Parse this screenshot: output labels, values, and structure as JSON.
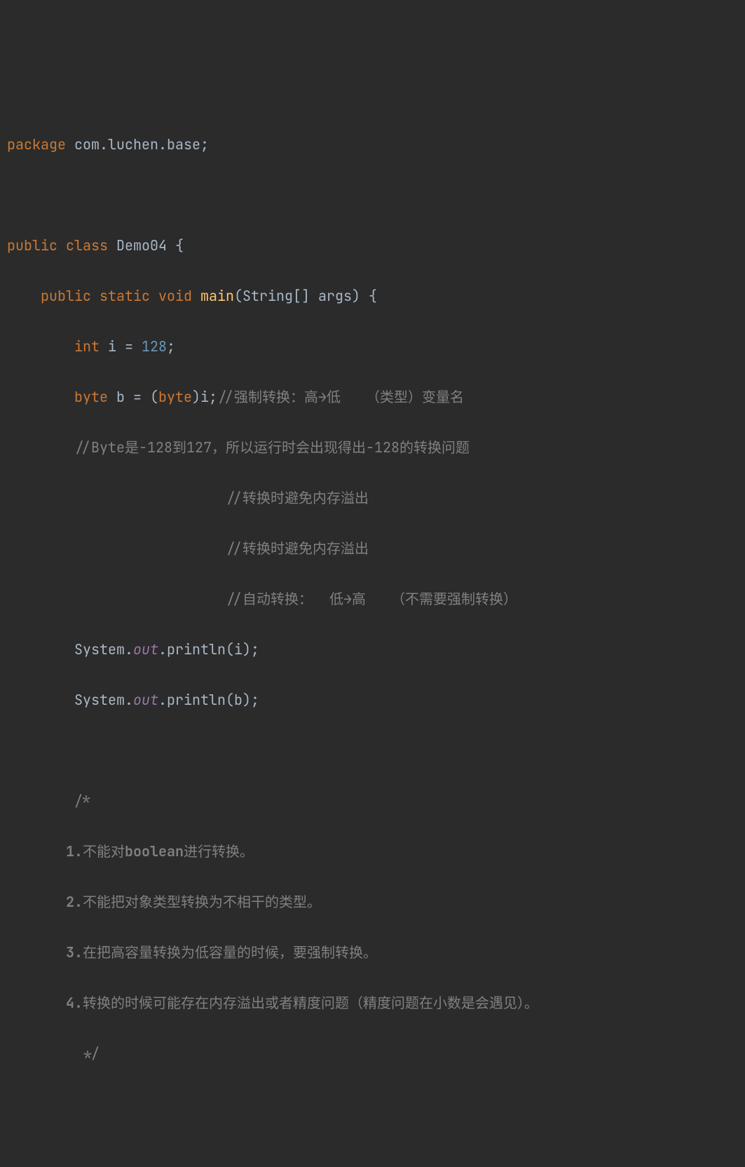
{
  "code": {
    "line1": {
      "package_kw": "package",
      "package_name": " com.luchen.base",
      "semi": ";"
    },
    "line3": {
      "public_kw": "public ",
      "class_kw": "class",
      "class_name": " Demo04 ",
      "brace": "{"
    },
    "line4": {
      "indent": "    ",
      "public_kw": "public ",
      "static_kw": "static ",
      "void_kw": "void",
      "method_name": " main",
      "params": "(String[] args) ",
      "brace": "{"
    },
    "line5": {
      "indent": "        ",
      "type_kw": "int",
      "var": " i = ",
      "number": "128",
      "semi": ";"
    },
    "line6": {
      "indent": "        ",
      "type_kw": "byte",
      "var": " b = (",
      "cast_kw": "byte",
      "rest": ")i",
      "semi": ";",
      "comment": "//强制转换：高→低   （类型）变量名"
    },
    "line7": {
      "indent": "        ",
      "comment_prefix": "//Byte是-128到127，所以运行时会出现得出-128的转换问题"
    },
    "line8": {
      "indent": "                          ",
      "comment": "//转换时避免内存溢出"
    },
    "line9": {
      "indent": "                          ",
      "comment": "//转换时避免内存溢出"
    },
    "line10": {
      "indent": "                          ",
      "comment": "//自动转换：  低→高   （不需要强制转换）"
    },
    "line11": {
      "indent": "        ",
      "system": "System.",
      "out": "out",
      "println": ".println(i)",
      "semi": ";"
    },
    "line12": {
      "indent": "        ",
      "system": "System.",
      "out": "out",
      "println": ".println(b)",
      "semi": ";"
    },
    "line14": {
      "indent": "        ",
      "comment": "/*"
    },
    "line15": {
      "indent": "       ",
      "bold": "1.",
      "text": "不能对",
      "bold2": "boolean",
      "text2": "进行转换。"
    },
    "line16": {
      "indent": "       ",
      "bold": "2.",
      "text": "不能把对象类型转换为不相干的类型。"
    },
    "line17": {
      "indent": "       ",
      "bold": "3.",
      "text": "在把高容量转换为低容量的时候，要强制转换。"
    },
    "line18": {
      "indent": "       ",
      "bold": "4.",
      "text": "转换的时候可能存在内存溢出或者精度问题（精度问题在小数是会遇见）。"
    },
    "line19": {
      "indent": "        ",
      "comment": " */"
    }
  }
}
